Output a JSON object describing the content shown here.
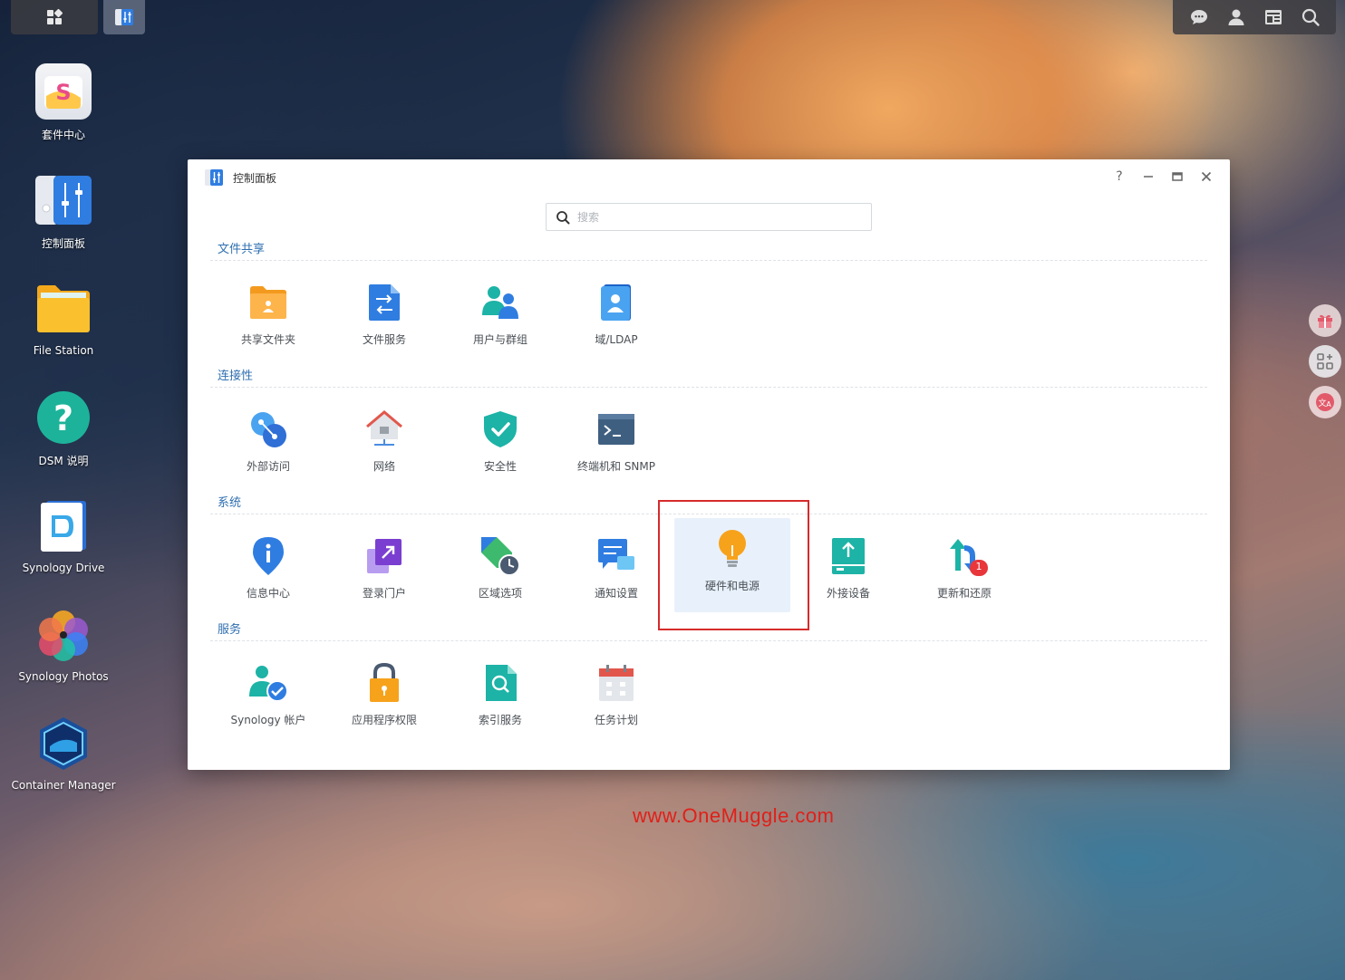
{
  "taskbar": {
    "main_menu_icon": "grid-icon",
    "open_app_icon": "control-panel-icon",
    "right_icons": [
      "chat-icon",
      "user-icon",
      "widgets-icon",
      "search-icon"
    ]
  },
  "desktop": {
    "icons": [
      {
        "label": "套件中心"
      },
      {
        "label": "控制面板"
      },
      {
        "label": "File Station"
      },
      {
        "label": "DSM 说明"
      },
      {
        "label": "Synology Drive"
      },
      {
        "label": "Synology Photos"
      },
      {
        "label": "Container Manager"
      }
    ]
  },
  "floating_buttons": [
    "gift-icon",
    "add-widget-icon",
    "translate-icon"
  ],
  "window": {
    "title": "控制面板",
    "controls": {
      "help": "?",
      "minimize": "–",
      "maximize": "▭",
      "close": "✕"
    },
    "search": {
      "placeholder": "搜索",
      "value": ""
    },
    "sections": [
      {
        "title": "文件共享",
        "items": [
          {
            "label": "共享文件夹"
          },
          {
            "label": "文件服务"
          },
          {
            "label": "用户与群组"
          },
          {
            "label": "域/LDAP"
          }
        ]
      },
      {
        "title": "连接性",
        "items": [
          {
            "label": "外部访问"
          },
          {
            "label": "网络"
          },
          {
            "label": "安全性"
          },
          {
            "label": "终端机和 SNMP"
          }
        ]
      },
      {
        "title": "系统",
        "items": [
          {
            "label": "信息中心"
          },
          {
            "label": "登录门户"
          },
          {
            "label": "区域选项"
          },
          {
            "label": "通知设置"
          },
          {
            "label": "硬件和电源"
          },
          {
            "label": "外接设备"
          },
          {
            "label": "更新和还原",
            "badge": "1"
          }
        ]
      },
      {
        "title": "服务",
        "items": [
          {
            "label": "Synology 帐户"
          },
          {
            "label": "应用程序权限"
          },
          {
            "label": "索引服务"
          },
          {
            "label": "任务计划"
          }
        ]
      }
    ],
    "selected_item": "硬件和电源"
  },
  "watermark": "www.OneMuggle.com",
  "colors": {
    "section_title": "#2f6fb0",
    "highlight": "#d62b2b",
    "selected_bg": "#e8f1fb"
  }
}
